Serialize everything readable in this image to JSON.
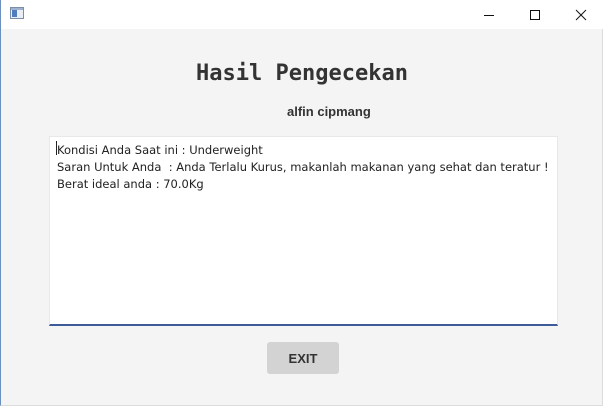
{
  "window": {
    "title": "",
    "controls": {
      "minimize_icon": "minimize-icon",
      "maximize_icon": "maximize-icon",
      "close_icon": "close-icon"
    }
  },
  "main": {
    "heading": "Hasil Pengecekan",
    "username": "alfin cipmang",
    "result_text": {
      "lines": [
        "Kondisi Anda Saat ini : Underweight",
        "Saran Untuk Anda  : Anda Terlalu Kurus, makanlah makanan yang sehat dan teratur !",
        "Berat ideal anda : 70.0Kg"
      ]
    },
    "exit_label": "EXIT"
  },
  "colors": {
    "background": "#f4f4f4",
    "textarea_focus_border": "#3d5a99",
    "button_bg": "#d3d3d3",
    "text": "#333333"
  }
}
